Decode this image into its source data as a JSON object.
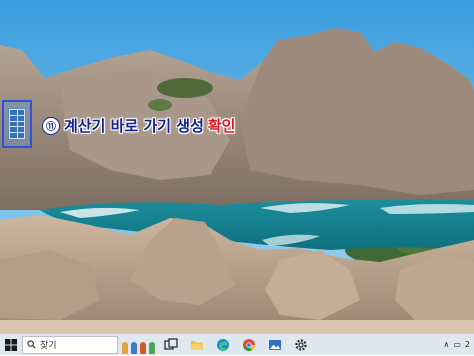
{
  "desktop": {
    "wallpaper": "coastal-granite-rocks-and-turquoise-sea",
    "caption": {
      "number": "⑪",
      "text": "계산기 바로 가기 생성",
      "accent": "확인",
      "text_color": "#14228a",
      "accent_color": "#e0151f"
    },
    "shortcut_icon": "calculator-shortcut-icon",
    "selection_color": "#2b53d8"
  },
  "taskbar": {
    "start_icon": "windows-start-icon",
    "search_placeholder": "찾기",
    "pinned": [
      "task-view-icon",
      "file-explorer-icon",
      "edge-icon",
      "chrome-icon",
      "photos-icon",
      "settings-icon"
    ],
    "clock_fragment": "2"
  }
}
